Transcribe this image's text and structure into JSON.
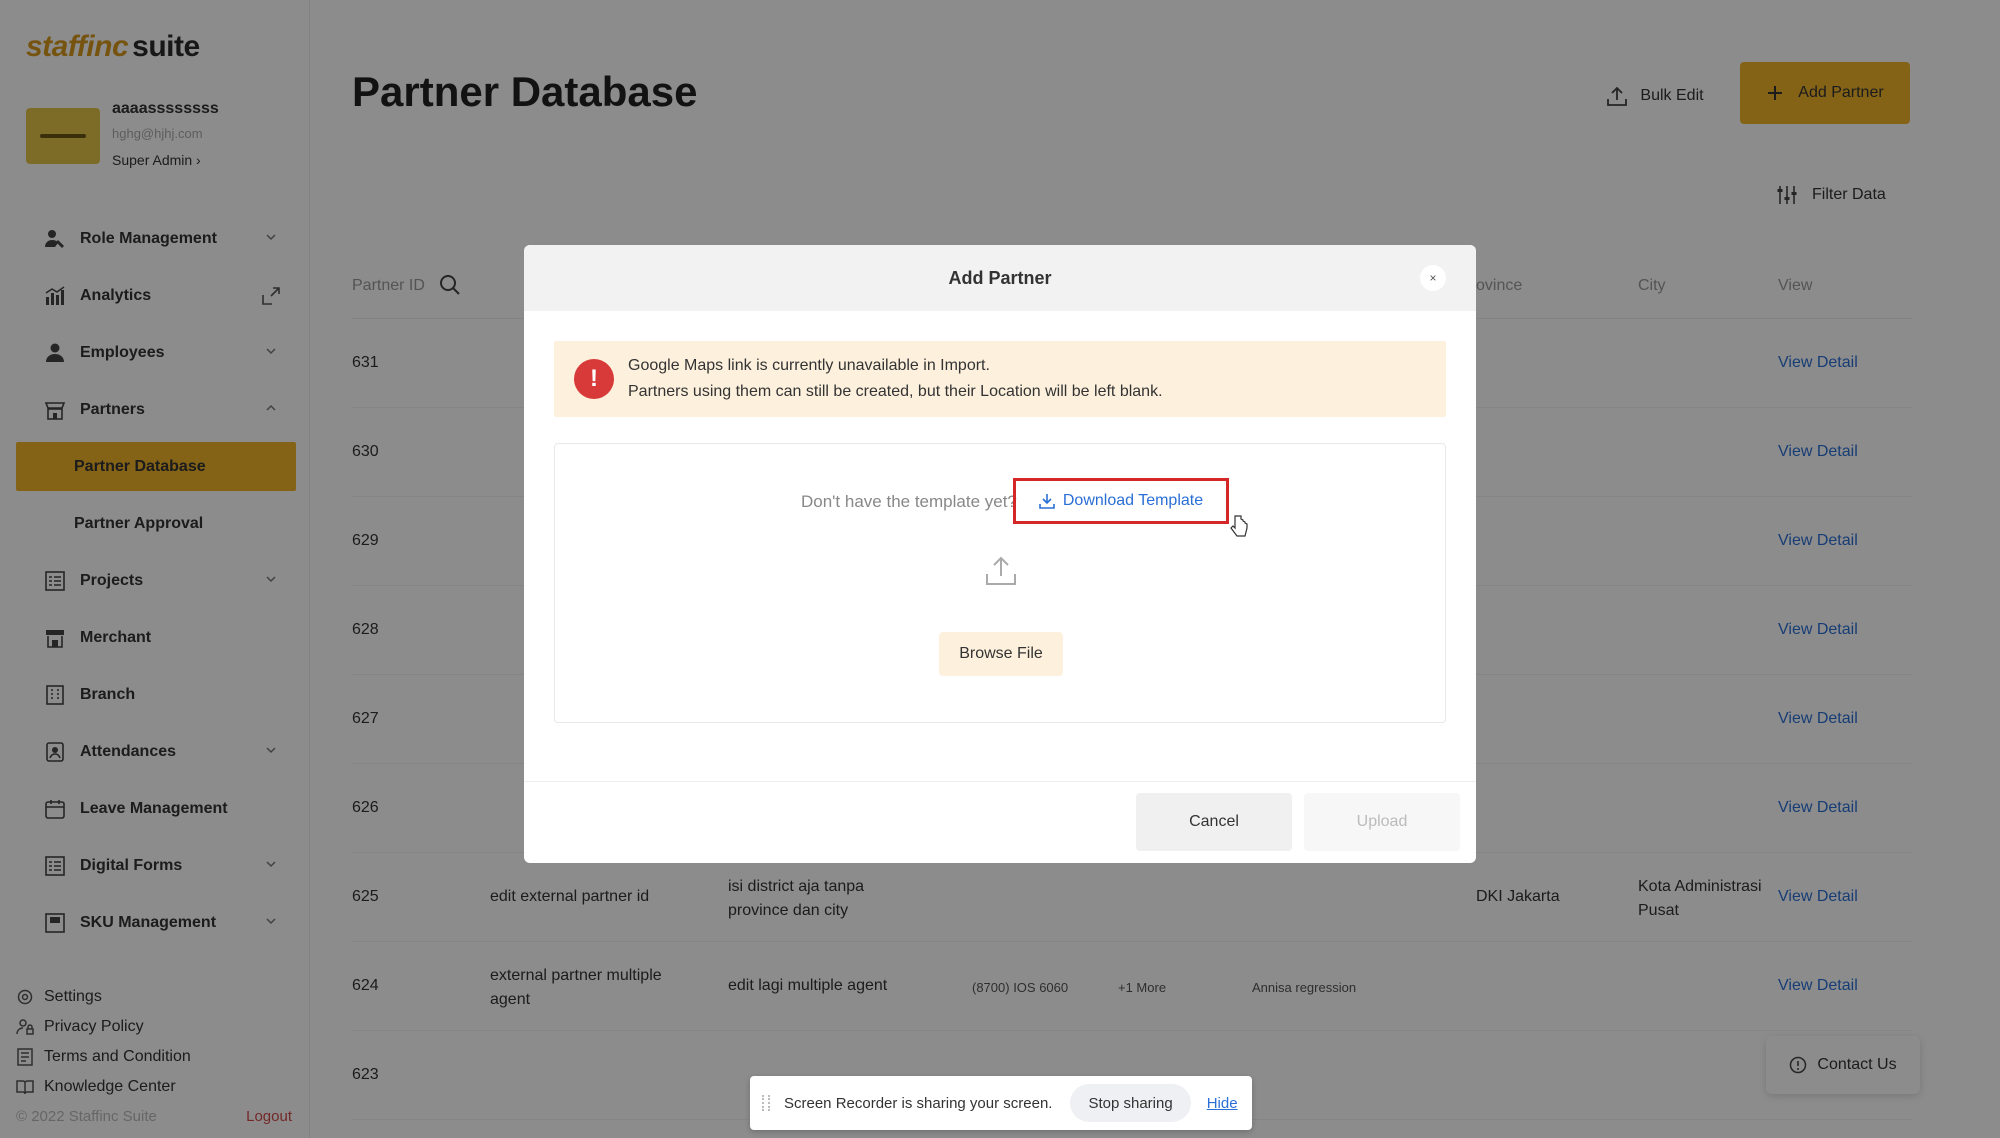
{
  "sidebar": {
    "logo_brand": "staffinc",
    "logo_suite": "suite",
    "user": {
      "name": "aaaassssssss",
      "email": "hghg@hjhj.com",
      "role": "Super Admin ›"
    },
    "nav": [
      {
        "label": "Role Management",
        "icon": "role-icon",
        "chevron": true
      },
      {
        "label": "Analytics",
        "icon": "analytics-icon",
        "external": true
      },
      {
        "label": "Employees",
        "icon": "employees-icon",
        "chevron": true
      },
      {
        "label": "Partners",
        "icon": "partners-icon",
        "chevron": true,
        "expanded": true
      }
    ],
    "partners_sub": [
      {
        "label": "Partner Database",
        "active": true
      },
      {
        "label": "Partner Approval",
        "active": false
      }
    ],
    "nav_after": [
      {
        "label": "Projects",
        "icon": "projects-icon",
        "chevron": true
      },
      {
        "label": "Merchant",
        "icon": "merchant-icon"
      },
      {
        "label": "Branch",
        "icon": "branch-icon"
      },
      {
        "label": "Attendances",
        "icon": "attendances-icon",
        "chevron": true
      },
      {
        "label": "Leave Management",
        "icon": "leave-icon"
      },
      {
        "label": "Digital Forms",
        "icon": "forms-icon",
        "chevron": true
      },
      {
        "label": "SKU Management",
        "icon": "sku-icon",
        "chevron": true
      }
    ],
    "bottom_links": [
      {
        "label": "Settings",
        "icon": "gear-icon"
      },
      {
        "label": "Privacy Policy",
        "icon": "privacy-icon"
      },
      {
        "label": "Terms and Condition",
        "icon": "terms-icon"
      },
      {
        "label": "Knowledge Center",
        "icon": "book-icon"
      }
    ],
    "copyright": "© 2022 Staffinc Suite",
    "logout": "Logout"
  },
  "main": {
    "title": "Partner Database",
    "bulk_edit": "Bulk Edit",
    "add_partner": "Add Partner",
    "filter": "Filter Data",
    "columns": {
      "partner_id": "Partner ID",
      "province": "ovince",
      "city": "City",
      "view": "View"
    },
    "rows": [
      {
        "id": "631",
        "view": "View Detail"
      },
      {
        "id": "630",
        "view": "View Detail"
      },
      {
        "id": "629",
        "view": "View Detail"
      },
      {
        "id": "628",
        "view": "View Detail"
      },
      {
        "id": "627",
        "view": "View Detail"
      },
      {
        "id": "626",
        "view": "View Detail"
      },
      {
        "id": "625",
        "external": "edit external partner id",
        "name": "isi district aja tanpa province dan city",
        "province": "DKI Jakarta",
        "city": "Kota Administrasi Pusat",
        "view": "View Detail"
      },
      {
        "id": "624",
        "external": "external partner multiple agent",
        "name": "edit lagi multiple agent",
        "phone": "(8700) IOS 6060",
        "more": "+1 More",
        "agent": "Annisa regression",
        "view": "View Detail"
      },
      {
        "id": "623"
      }
    ],
    "contact": "Contact Us"
  },
  "modal": {
    "title": "Add Partner",
    "close": "×",
    "warning_line1": "Google Maps link is currently unavailable in Import.",
    "warning_line2": "Partners using them can still be created, but their Location will be left blank.",
    "template_question": "Don't have the template yet?",
    "download_template": "Download Template",
    "browse_file": "Browse File",
    "cancel": "Cancel",
    "upload": "Upload"
  },
  "recorder": {
    "message": "Screen Recorder is sharing your screen.",
    "stop": "Stop sharing",
    "hide": "Hide"
  },
  "colors": {
    "accent": "#f0b42a",
    "link": "#2a6fd6",
    "danger": "#d83a3a",
    "warning_bg": "#fdf1dd"
  }
}
